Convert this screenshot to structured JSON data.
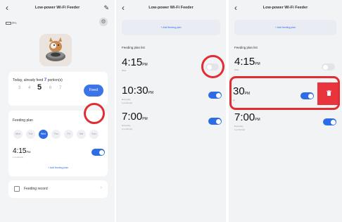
{
  "panel1": {
    "title": "Low-power Wi-Fi Feeder",
    "battery": "9%",
    "fed_prefix": "Today, already feed",
    "fed_count": "7",
    "fed_suffix": "portion(s)",
    "portions": [
      "3",
      "4",
      "5",
      "6",
      "7"
    ],
    "selected_portion": "5",
    "feed_button": "Feed",
    "plan_title": "Feeding plan",
    "more": "···",
    "days": [
      "Mon",
      "Tue",
      "Wed",
      "Thu",
      "Fri",
      "Sat",
      "Sun"
    ],
    "active_day": "Wed",
    "plan_time": "4:15",
    "plan_ampm": "PM",
    "plan_portion": "1 portion(s)",
    "add_plan": "+ Add feeding plan",
    "record_label": "Feeding record",
    "chevron": "›"
  },
  "panel2": {
    "title": "Low-power Wi-Fi Feeder",
    "add_plan": "+ Add feeding plan",
    "list_title": "Feeding plan list",
    "items": [
      {
        "time": "4:15",
        "ampm": "PM",
        "days": "Wed",
        "portion": "1 portion(s)",
        "enabled": false
      },
      {
        "time": "10:30",
        "ampm": "PM",
        "days": "Everyday",
        "portion": "1 portion(s)",
        "enabled": true
      },
      {
        "time": "7:00",
        "ampm": "PM",
        "days": "Everyday",
        "portion": "1 portion(s)",
        "enabled": true
      }
    ]
  },
  "panel3": {
    "title": "Low-power Wi-Fi Feeder",
    "add_plan": "+ Add feeding plan",
    "list_title": "Feeding plan list",
    "items": [
      {
        "time": "4:15",
        "ampm": "PM",
        "days": "Wed",
        "portion": "",
        "enabled": false
      },
      {
        "time": "30",
        "ampm": "PM",
        "days": "ay",
        "portion": "",
        "enabled": true
      },
      {
        "time": "7:00",
        "ampm": "PM",
        "days": "Everyday",
        "portion": "1 portion(s)",
        "enabled": true
      }
    ],
    "delete_icon": "trash-icon"
  },
  "colors": {
    "accent": "#2e6ce6",
    "highlight": "#e02e35",
    "delete": "#e8343c"
  }
}
